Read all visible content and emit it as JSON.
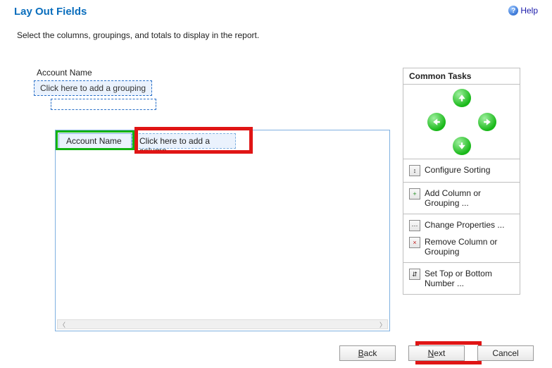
{
  "header": {
    "title": "Lay Out Fields",
    "help_label": "Help"
  },
  "instruction": "Select the columns, groupings, and totals to display in the report.",
  "layout": {
    "field_label": "Account Name",
    "grouping_placeholder": "Click here to add a grouping",
    "columns": {
      "account": "Account Name",
      "add_placeholder": "Click here to add a column"
    }
  },
  "tasks": {
    "title": "Common Tasks",
    "items": {
      "configure_sorting": "Configure Sorting",
      "add_column": "Add Column or Grouping ...",
      "change_properties": "Change Properties ...",
      "remove_column": "Remove Column or Grouping",
      "set_top": "Set Top or Bottom Number ..."
    }
  },
  "footer": {
    "back": "Back",
    "next": "Next",
    "cancel": "Cancel"
  },
  "highlight": {
    "green_target": "columns.account",
    "red_targets": [
      "columns.add_placeholder",
      "footer.next"
    ]
  }
}
